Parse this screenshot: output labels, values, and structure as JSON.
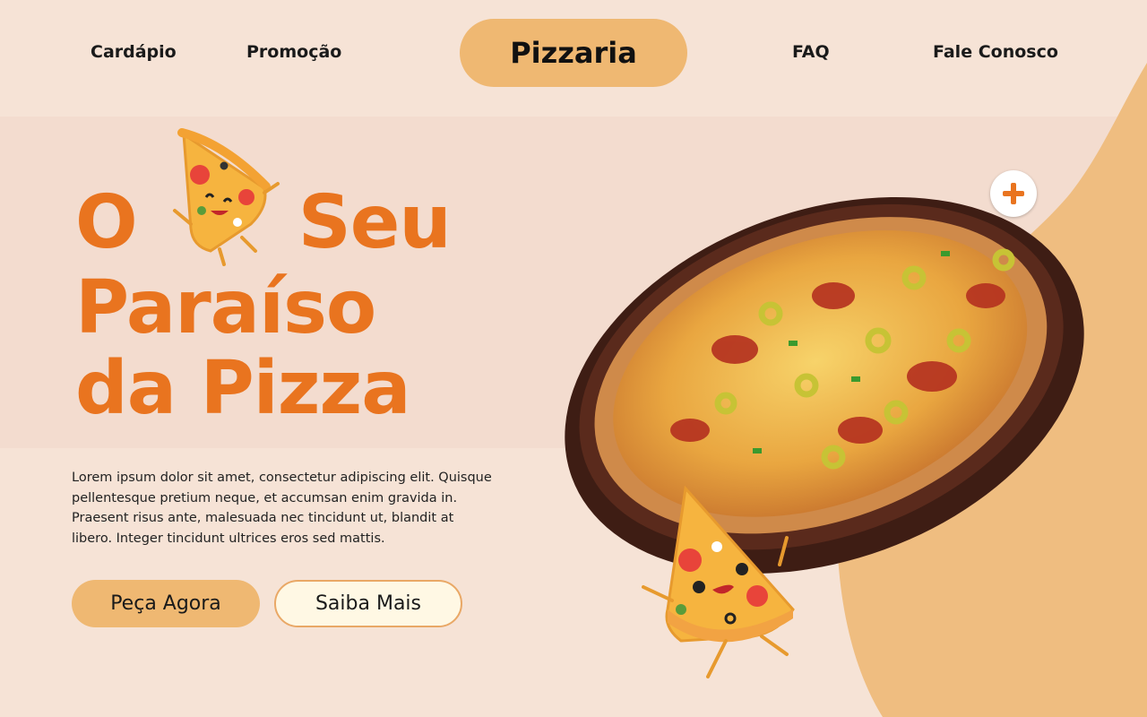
{
  "nav": {
    "items": [
      {
        "label": "Cardápio"
      },
      {
        "label": "Promoção"
      },
      {
        "label": "FAQ"
      },
      {
        "label": "Fale Conosco"
      }
    ],
    "brand": "Pizzaria"
  },
  "hero": {
    "headline_line1_word1": "O",
    "headline_line1_word2": "Seu",
    "headline_line2": "Paraíso",
    "headline_line3": "da Pizza",
    "description": "Lorem ipsum dolor sit amet, consectetur adipiscing elit. Quisque pellentesque pretium neque, et accumsan enim gravida in. Praesent risus ante, malesuada nec tincidunt ut, blandit at libero. Integer tincidunt ultrices eros sed mattis.",
    "primary_button": "Peça Agora",
    "secondary_button": "Saiba Mais"
  },
  "icons": {
    "add": "plus-icon",
    "mascot": "pizza-slice-mascot",
    "pizza": "pizza-in-pan"
  },
  "colors": {
    "accent_orange": "#e9741f",
    "pill_gold": "#efb872",
    "background": "#f6e3d6"
  }
}
